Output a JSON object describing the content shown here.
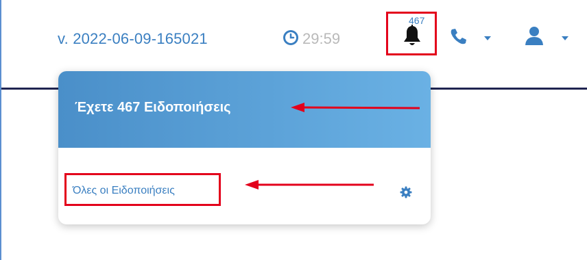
{
  "header": {
    "version": "v. 2022-06-09-165021",
    "timer": "29:59",
    "notification_count": "467"
  },
  "dropdown": {
    "title": "Έχετε 467 Ειδοποιήσεις",
    "all_link": "Όλες οι Ειδοποιήσεις"
  },
  "icons": {
    "clock": "clock-icon",
    "bell": "bell-icon",
    "phone": "phone-icon",
    "user": "user-icon",
    "gear": "gear-icon"
  },
  "colors": {
    "accent": "#3a7fc1",
    "highlight": "#e3001b",
    "header_gradient_start": "#4a8fc9",
    "header_gradient_end": "#6ab1e4",
    "timer_gray": "#b9b9b9"
  }
}
